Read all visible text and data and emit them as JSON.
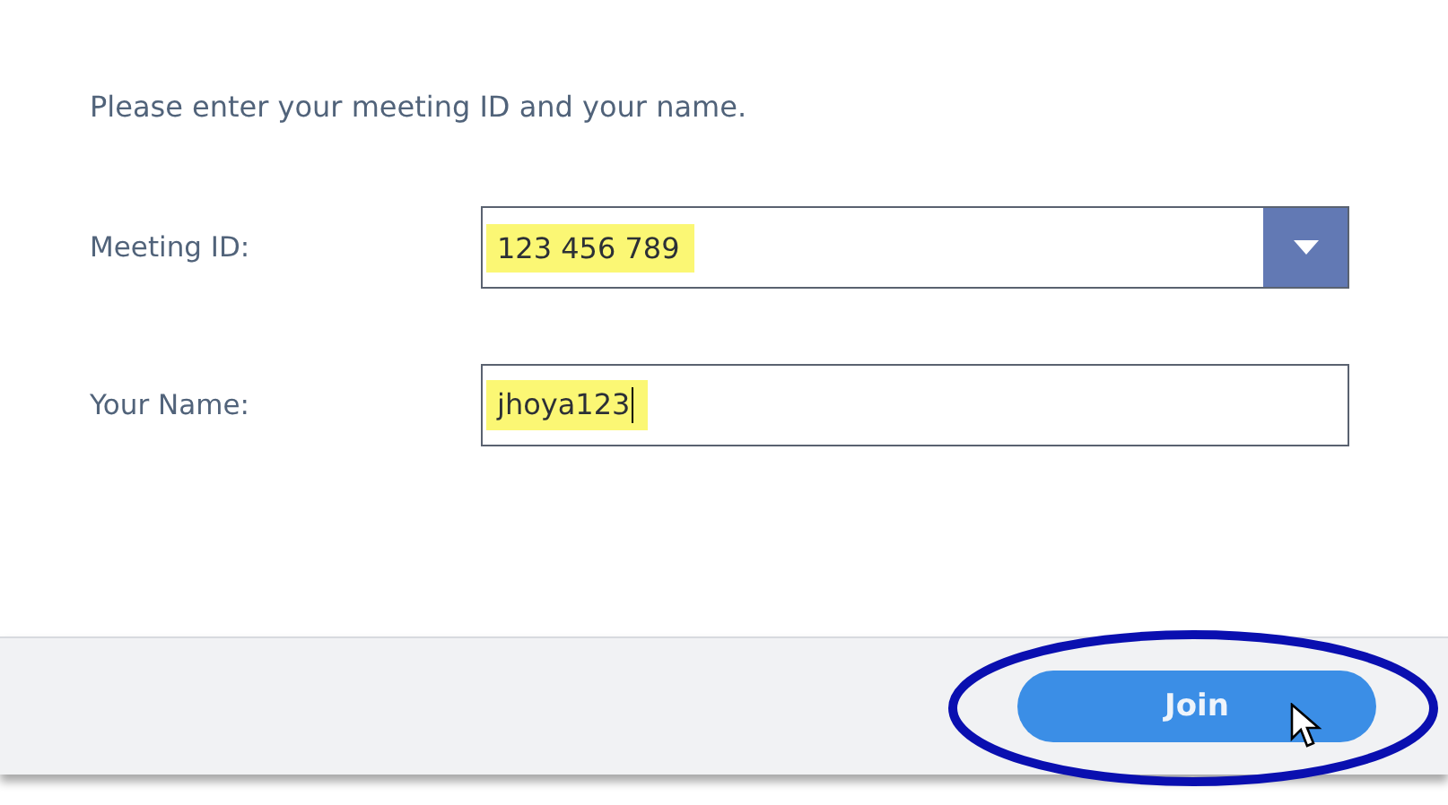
{
  "instruction": "Please enter your meeting ID and your name.",
  "fields": [
    {
      "kind": "dropdown",
      "label": "Meeting ID:",
      "value": "123 456 789",
      "highlighted": true,
      "caret": false
    },
    {
      "kind": "text",
      "label": "Your Name:",
      "value": "jhoya123",
      "highlighted": true,
      "caret": true
    }
  ],
  "footer": {
    "button": "Join",
    "circled": true
  }
}
